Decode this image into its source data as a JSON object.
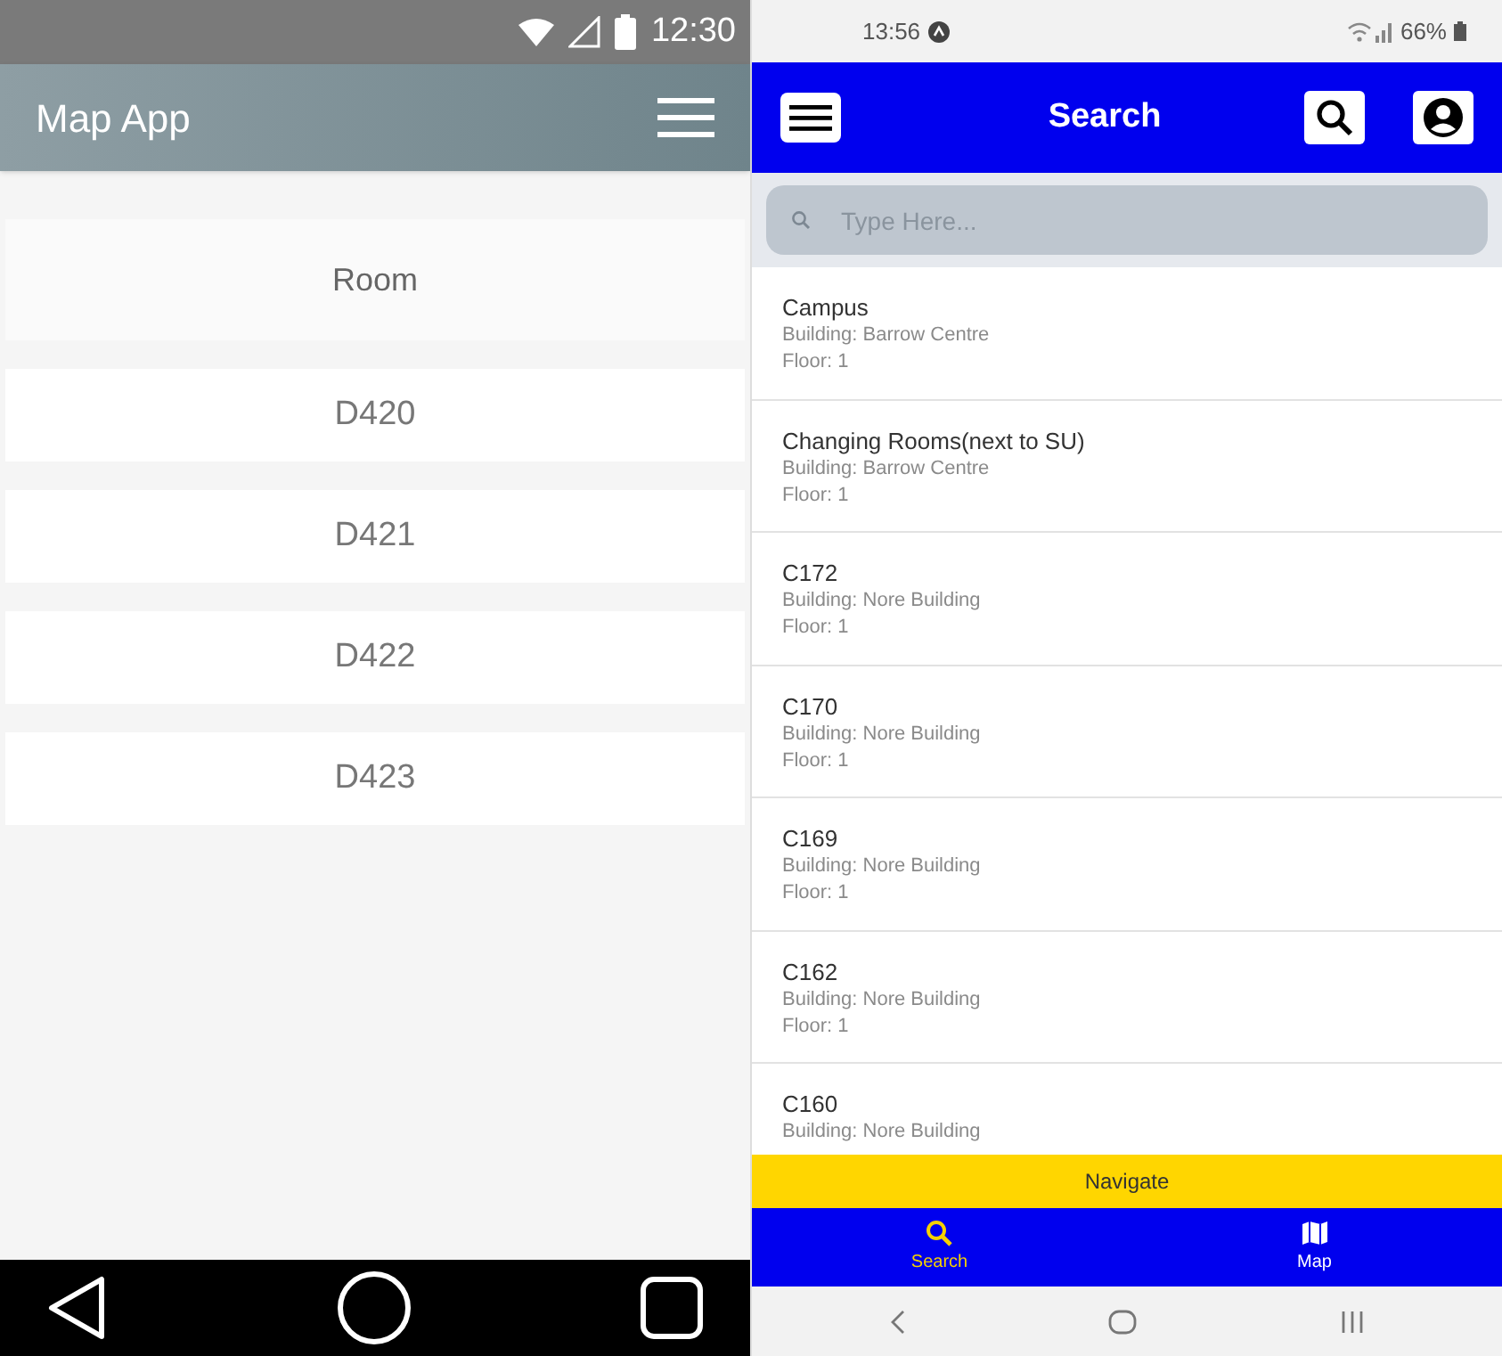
{
  "left_phone": {
    "status_bar": {
      "time": "12:30"
    },
    "app_bar": {
      "title": "Map App"
    },
    "list_header": "Room",
    "rooms": [
      "D420",
      "D421",
      "D422",
      "D423"
    ]
  },
  "right_phone": {
    "status_bar": {
      "time": "13:56",
      "battery": "66%"
    },
    "header": {
      "title": "Search"
    },
    "search": {
      "placeholder": "Type Here..."
    },
    "results": [
      {
        "name": "Campus",
        "building": "Building: Barrow Centre",
        "floor": "Floor: 1"
      },
      {
        "name": "Changing Rooms(next to SU)",
        "building": "Building: Barrow Centre",
        "floor": "Floor: 1"
      },
      {
        "name": "C172",
        "building": "Building: Nore Building",
        "floor": "Floor: 1"
      },
      {
        "name": "C170",
        "building": "Building: Nore Building",
        "floor": "Floor: 1"
      },
      {
        "name": "C169",
        "building": "Building: Nore Building",
        "floor": "Floor: 1"
      },
      {
        "name": "C162",
        "building": "Building: Nore Building",
        "floor": "Floor: 1"
      },
      {
        "name": "C160",
        "building": "Building: Nore Building"
      }
    ],
    "navigate_button": "Navigate",
    "tabs": [
      {
        "label": "Search",
        "kind": "search"
      },
      {
        "label": "Map",
        "kind": "map"
      }
    ]
  }
}
